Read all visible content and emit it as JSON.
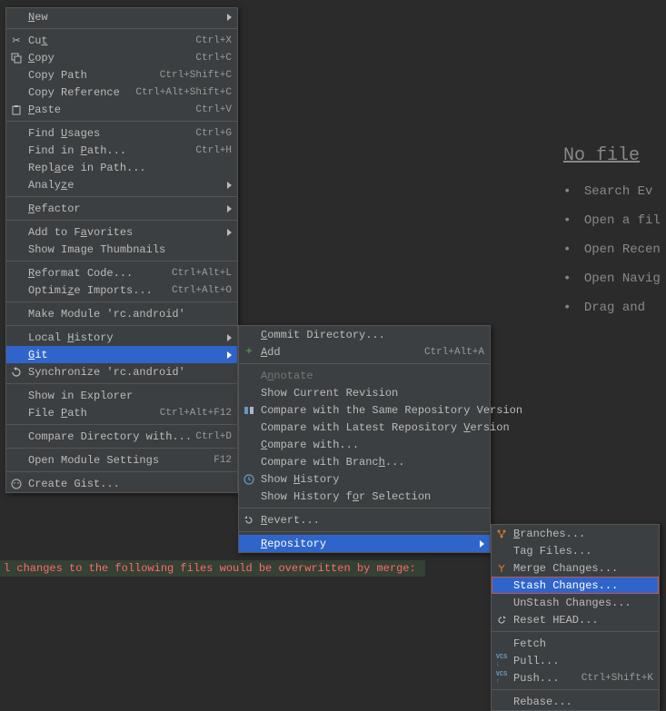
{
  "editor": {
    "title": "No file",
    "hints": [
      "Search Ev",
      "Open a fil",
      "Open Recen",
      "Open Navig",
      "Drag and "
    ]
  },
  "console": {
    "line": "l changes to the following files would be overwritten by merge:"
  },
  "menu1": {
    "new": "New",
    "cut": "Cut",
    "cut_sc": "Ctrl+X",
    "copy": "Copy",
    "copy_sc": "Ctrl+C",
    "copy_path": "Copy Path",
    "copy_path_sc": "Ctrl+Shift+C",
    "copy_ref": "Copy Reference",
    "copy_ref_sc": "Ctrl+Alt+Shift+C",
    "paste": "Paste",
    "paste_sc": "Ctrl+V",
    "find_usages": "Find Usages",
    "find_usages_sc": "Ctrl+G",
    "find_in_path": "Find in Path...",
    "find_in_path_sc": "Ctrl+H",
    "replace_in_path": "Replace in Path...",
    "analyze": "Analyze",
    "refactor": "Refactor",
    "add_fav": "Add to Favorites",
    "show_thumb": "Show Image Thumbnails",
    "reformat": "Reformat Code...",
    "reformat_sc": "Ctrl+Alt+L",
    "optimize": "Optimize Imports...",
    "optimize_sc": "Ctrl+Alt+O",
    "make_module": "Make Module 'rc.android'",
    "local_history": "Local History",
    "git": "Git",
    "sync": "Synchronize 'rc.android'",
    "show_explorer": "Show in Explorer",
    "file_path": "File Path",
    "file_path_sc": "Ctrl+Alt+F12",
    "compare_dir": "Compare Directory with...",
    "compare_dir_sc": "Ctrl+D",
    "open_module": "Open Module Settings",
    "open_module_sc": "F12",
    "create_gist": "Create Gist..."
  },
  "menu2": {
    "commit_dir": "Commit Directory...",
    "add": "Add",
    "add_sc": "Ctrl+Alt+A",
    "annotate": "Annotate",
    "show_cur_rev": "Show Current Revision",
    "compare_same": "Compare with the Same Repository Version",
    "compare_latest": "Compare with Latest Repository Version",
    "compare_with": "Compare with...",
    "compare_branch": "Compare with Branch...",
    "show_history": "Show History",
    "show_history_sel": "Show History for Selection",
    "revert": "Revert...",
    "repository": "Repository"
  },
  "menu3": {
    "branches": "Branches...",
    "tag_files": "Tag Files...",
    "merge_changes": "Merge Changes...",
    "stash": "Stash Changes...",
    "unstash": "UnStash Changes...",
    "reset_head": "Reset HEAD...",
    "fetch": "Fetch",
    "pull": "Pull...",
    "push": "Push...",
    "push_sc": "Ctrl+Shift+K",
    "rebase": "Rebase..."
  }
}
